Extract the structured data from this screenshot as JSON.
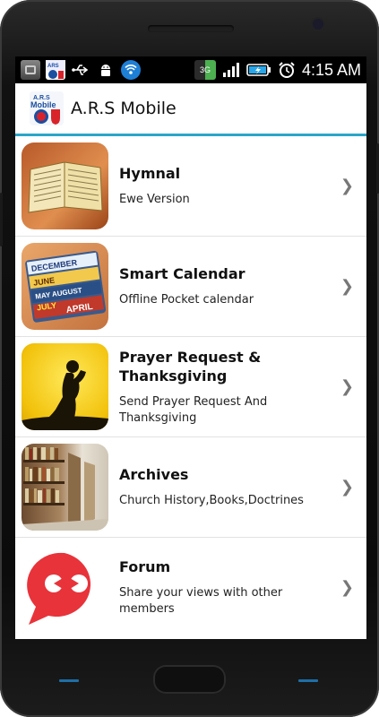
{
  "statusbar": {
    "time": "4:15 AM",
    "left_icons": [
      "device-manager-icon",
      "ars-mobile-icon",
      "usb-icon",
      "android-debug-icon",
      "wifi-hotspot-icon"
    ],
    "right_icons": [
      "3g-icon",
      "signal-icon",
      "battery-charging-icon",
      "alarm-icon"
    ]
  },
  "appbar": {
    "title": "A.R.S Mobile",
    "logo_text_top": "A.R.S",
    "logo_text_bottom": "Mobile"
  },
  "items": [
    {
      "title": "Hymnal",
      "subtitle": "Ewe Version",
      "thumb": "book-thumbnail"
    },
    {
      "title": "Smart Calendar",
      "subtitle": "Offline Pocket calendar",
      "thumb": "calendar-thumbnail"
    },
    {
      "title": "Prayer Request & Thanksgiving",
      "subtitle": "Send Prayer Request And Thanksgiving",
      "thumb": "praying-thumbnail"
    },
    {
      "title": "Archives",
      "subtitle": "Church History,Books,Doctrines",
      "thumb": "library-thumbnail"
    },
    {
      "title": "Forum",
      "subtitle": "Share your views with other members",
      "thumb": "chat-thumbnail"
    }
  ],
  "calendar_thumb_text": {
    "line1": "DECEMBER",
    "line2": "JUNE",
    "line3": "MAY AUGUST",
    "line4": "JULY",
    "line5": "APRIL"
  },
  "status_text": {
    "three_g": "3G"
  },
  "colors": {
    "accent": "#2aa6c8",
    "statusbar": "#000000",
    "nav_dash": "#1e6fa8"
  }
}
